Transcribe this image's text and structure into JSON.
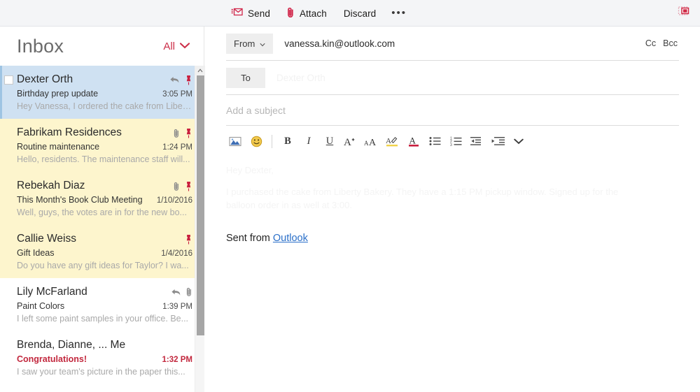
{
  "toolbar": {
    "send_label": "Send",
    "attach_label": "Attach",
    "discard_label": "Discard",
    "more_label": "•••",
    "send_icon": "send-envelope-icon",
    "attach_icon": "paperclip-icon",
    "popout_icon": "open-in-new-window-icon",
    "accent_color": "#d1264a"
  },
  "list": {
    "title": "Inbox",
    "filter_label": "All",
    "filter_icon": "chevron-down-icon",
    "items": [
      {
        "sender": "Dexter Orth",
        "subject": "Birthday prep update",
        "time": "3:05 PM",
        "preview": "Hey Vanessa, I ordered the cake from Liber...",
        "state": "selected",
        "checkbox": true,
        "icons": [
          "reply-icon",
          "pin-icon"
        ],
        "unread": false
      },
      {
        "sender": "Fabrikam Residences",
        "subject": "Routine maintenance",
        "time": "1:24 PM",
        "preview": "Hello, residents. The maintenance staff will...",
        "state": "flagged",
        "checkbox": false,
        "icons": [
          "paperclip-icon",
          "pin-icon"
        ],
        "unread": false
      },
      {
        "sender": "Rebekah Diaz",
        "subject": "This Month's Book Club Meeting",
        "time": "1/10/2016",
        "preview": "Well, guys, the votes are in for the new bo...",
        "state": "flagged",
        "checkbox": false,
        "icons": [
          "paperclip-icon",
          "pin-icon"
        ],
        "unread": false
      },
      {
        "sender": "Callie Weiss",
        "subject": "Gift Ideas",
        "time": "1/4/2016",
        "preview": "Do you have any gift ideas for Taylor? I wa...",
        "state": "flagged",
        "checkbox": false,
        "icons": [
          "pin-icon"
        ],
        "unread": false
      },
      {
        "sender": "Lily McFarland",
        "subject": "Paint Colors",
        "time": "1:39 PM",
        "preview": "I left some paint samples in your office. Be...",
        "state": "plain",
        "checkbox": false,
        "icons": [
          "reply-icon",
          "paperclip-icon"
        ],
        "unread": false
      },
      {
        "sender": "Brenda, Dianne, ... Me",
        "subject": "Congratulations!",
        "time": "1:32 PM",
        "preview": "I saw your team's picture in the paper this...",
        "state": "plain",
        "checkbox": false,
        "icons": [],
        "unread": true
      }
    ]
  },
  "compose": {
    "from_label": "From",
    "from_value": "vanessa.kin@outlook.com",
    "from_caret": "caret-down-icon",
    "cc_label": "Cc",
    "bcc_label": "Bcc",
    "to_label": "To",
    "to_value": "",
    "to_ghost": "Dexter Orth",
    "subject_placeholder": "Add a subject",
    "body_ghost_1": "Hey Dexter,",
    "body_ghost_2": "I purchased the cake from Liberty Bakery. They have a 1:15 PM pickup window. Signed up for the",
    "body_ghost_3": "balloon order in as well at 3:00.",
    "signature_prefix": "Sent from ",
    "signature_link": "Outlook",
    "link_color": "#2a6fc9",
    "format_tools": [
      {
        "name": "insert-picture-icon",
        "label": "Insert picture"
      },
      {
        "name": "emoji-icon",
        "label": "Emoji"
      },
      {
        "name": "bold-icon",
        "label": "B"
      },
      {
        "name": "italic-icon",
        "label": "I"
      },
      {
        "name": "underline-icon",
        "label": "U"
      },
      {
        "name": "grow-font-icon",
        "label": "A"
      },
      {
        "name": "shrink-font-icon",
        "label": "A"
      },
      {
        "name": "highlight-icon",
        "label": "Highlight"
      },
      {
        "name": "font-color-icon",
        "label": "A"
      },
      {
        "name": "bulleted-list-icon",
        "label": "Bulleted list"
      },
      {
        "name": "numbered-list-icon",
        "label": "Numbered list"
      },
      {
        "name": "decrease-indent-icon",
        "label": "Decrease indent"
      },
      {
        "name": "increase-indent-icon",
        "label": "Increase indent"
      },
      {
        "name": "more-formatting-icon",
        "label": "More"
      }
    ]
  }
}
